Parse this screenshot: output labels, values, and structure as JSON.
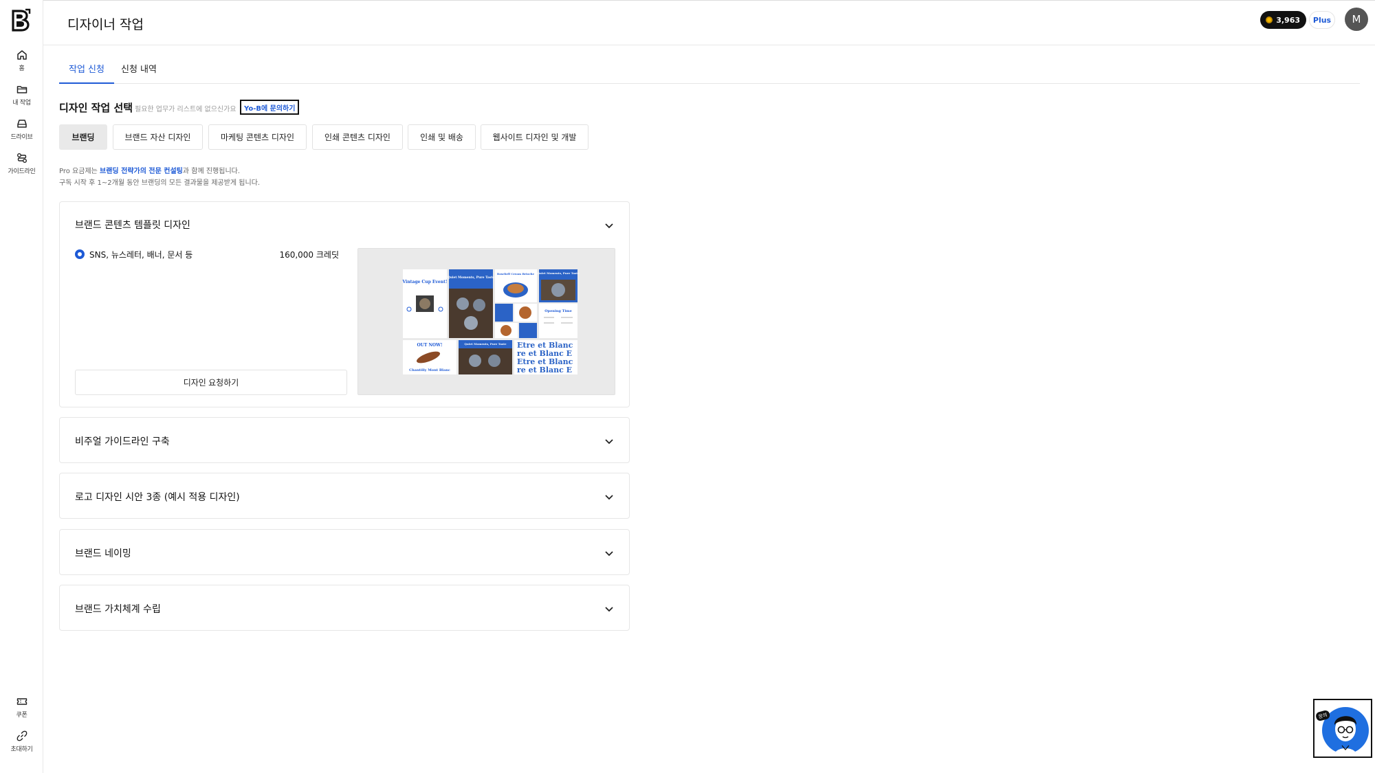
{
  "sidebar": {
    "items": [
      {
        "label": "홈",
        "icon": "home-icon"
      },
      {
        "label": "내 작업",
        "icon": "folder-icon"
      },
      {
        "label": "드라이브",
        "icon": "drive-icon"
      },
      {
        "label": "가이드라인",
        "icon": "guideline-icon"
      }
    ],
    "bottom_items": [
      {
        "label": "쿠폰",
        "icon": "coupon-icon"
      },
      {
        "label": "초대하기",
        "icon": "invite-icon"
      }
    ]
  },
  "header": {
    "title": "디자이너 작업",
    "credits": "3,963",
    "plan": "Plus",
    "avatar_initial": "M"
  },
  "tabs": [
    {
      "label": "작업 신청",
      "active": true
    },
    {
      "label": "신청 내역",
      "active": false
    }
  ],
  "section": {
    "title": "디자인 작업 선택",
    "hint": "필요한 업무가 리스트에 없으신가요",
    "inquire_link": "Yo-B에 문의하기"
  },
  "categories": [
    {
      "label": "브랜딩",
      "active": true
    },
    {
      "label": "브랜드 자산 디자인",
      "active": false
    },
    {
      "label": "마케팅 콘텐츠 디자인",
      "active": false
    },
    {
      "label": "인쇄 콘텐츠 디자인",
      "active": false
    },
    {
      "label": "인쇄 및 배송",
      "active": false
    },
    {
      "label": "웹사이트 디자인 및 개발",
      "active": false
    }
  ],
  "info": {
    "line1_prefix": "Pro 요금제는 ",
    "line1_highlight": "브랜딩 전략가의 전문 컨설팅",
    "line1_suffix": "과 함께 진행됩니다.",
    "line2": "구독 시작 후 1~2개월 동안 브랜딩의 모든 결과물을 제공받게 됩니다."
  },
  "cards": [
    {
      "title": "브랜드 콘텐츠 템플릿 디자인",
      "expanded": true,
      "option_label": "SNS, 뉴스레터, 배너, 문서 등",
      "option_price": "160,000 크레딧",
      "button_label": "디자인 요청하기"
    },
    {
      "title": "비주얼 가이드라인 구축",
      "expanded": false
    },
    {
      "title": "로고 디자인 시안 3종 (예시 적용 디자인)",
      "expanded": false
    },
    {
      "title": "브랜드 네이밍",
      "expanded": false
    },
    {
      "title": "브랜드 가치체계 수립",
      "expanded": false
    }
  ],
  "preview_texts": {
    "t1": "Vintage Cup Event!",
    "t2": "Quiet Moments, Pure Taste",
    "t3": "Rosebell Cream Brioche",
    "t4": "Quiet Moments, Pure Taste",
    "t5": "Opening Time",
    "t6": "OUT NOW!",
    "t7": "Chantilly Mont Blanc",
    "t8": "Quiet Moments, Pure Taste",
    "t9": "Etre et Blanc",
    "t10": "re et Blanc E",
    "t11": "Etre et Blanc",
    "t12": "re et Blanc E"
  },
  "chat_fab": {
    "badge": "문의"
  },
  "colors": {
    "accent": "#1e5ad6",
    "dark": "#111111",
    "chip_active": "#e9e9e9"
  }
}
